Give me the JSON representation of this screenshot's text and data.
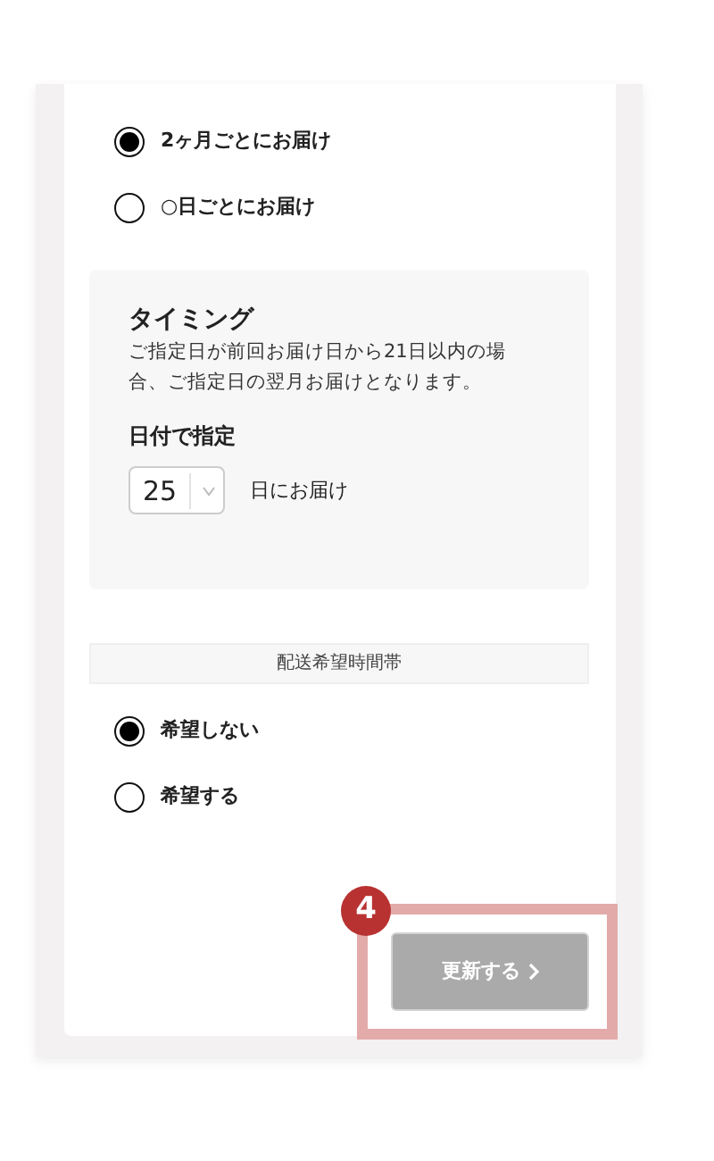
{
  "delivery_options": [
    {
      "label": "2ヶ月ごとにお届け",
      "selected": true
    },
    {
      "label": "○日ごとにお届け",
      "selected": false
    }
  ],
  "timing": {
    "title": "タイミング",
    "note": "ご指定日が前回お届け日から21日以内の場合、ご指定日の翌月お届けとなります。",
    "date_label": "日付で指定",
    "day_select": {
      "value": "25"
    },
    "suffix": "日にお届け"
  },
  "time_section": {
    "heading": "配送希望時間帯",
    "options": [
      {
        "label": "希望しない",
        "selected": true
      },
      {
        "label": "希望する",
        "selected": false
      }
    ]
  },
  "update_button": {
    "label": "更新する",
    "disabled": true
  },
  "callout": {
    "number": "4"
  }
}
